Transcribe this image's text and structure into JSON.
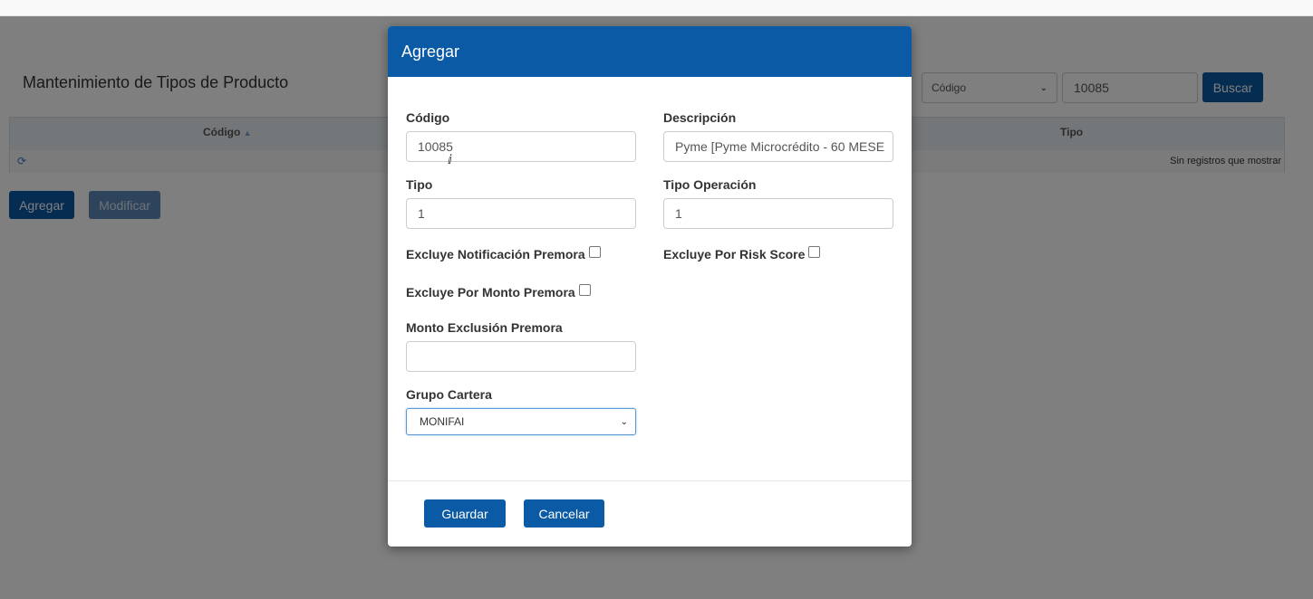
{
  "page": {
    "title": "Mantenimiento de Tipos de Producto",
    "filter_select_value": "Código",
    "filter_input_value": "10085",
    "search_label": "Buscar",
    "grid": {
      "col_codigo": "Código",
      "col_tipo": "Tipo",
      "empty_message": "Sin registros que mostrar"
    },
    "agregar_label": "Agregar",
    "modificar_label": "Modificar"
  },
  "modal": {
    "title": "Agregar",
    "codigo_label": "Código",
    "codigo_value": "10085",
    "descripcion_label": "Descripción",
    "descripcion_value": "Pyme [Pyme Microcrédito - 60 MESE",
    "tipo_label": "Tipo",
    "tipo_value": "1",
    "tipo_operacion_label": "Tipo Operación",
    "tipo_operacion_value": "1",
    "excluye_notificacion_label": "Excluye Notificación Premora",
    "excluye_risk_label": "Excluye Por Risk Score",
    "excluye_monto_label": "Excluye Por Monto Premora",
    "monto_exclusion_label": "Monto Exclusión Premora",
    "monto_exclusion_value": "",
    "grupo_cartera_label": "Grupo Cartera",
    "grupo_cartera_value": "MONIFAI",
    "guardar_label": "Guardar",
    "cancelar_label": "Cancelar"
  },
  "colors": {
    "primary": "#0a5aa5",
    "overlay": "rgba(0,0,0,0.5)"
  }
}
